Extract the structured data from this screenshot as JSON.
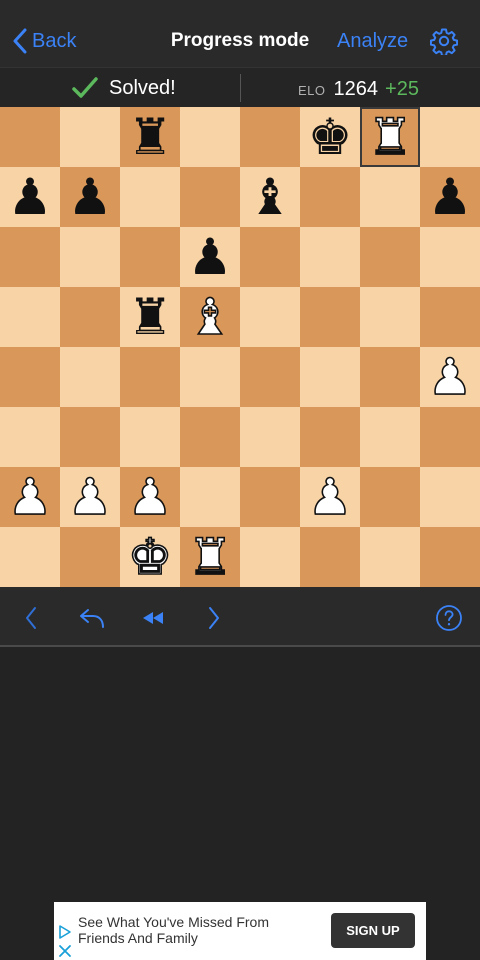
{
  "nav": {
    "back_label": "Back",
    "title": "Progress mode",
    "analyze_label": "Analyze",
    "settings_icon": "gear-icon"
  },
  "status": {
    "solved_label": "Solved!",
    "elo_label": "ELO",
    "elo_value": "1264",
    "elo_change": "+25"
  },
  "colors": {
    "accent": "#3b82f6",
    "success": "#5cb85c",
    "light_square": "#f7d3a6",
    "dark_square": "#d9975a",
    "background": "#232323"
  },
  "board": {
    "orientation": "white-bottom",
    "highlighted_square": "g8",
    "pieces": [
      {
        "square": "c8",
        "type": "rook",
        "color": "black"
      },
      {
        "square": "f8",
        "type": "king",
        "color": "black"
      },
      {
        "square": "g8",
        "type": "rook",
        "color": "white"
      },
      {
        "square": "a7",
        "type": "pawn",
        "color": "black"
      },
      {
        "square": "b7",
        "type": "pawn",
        "color": "black"
      },
      {
        "square": "e7",
        "type": "bishop",
        "color": "black"
      },
      {
        "square": "h7",
        "type": "pawn",
        "color": "black"
      },
      {
        "square": "d6",
        "type": "pawn",
        "color": "black"
      },
      {
        "square": "c5",
        "type": "rook",
        "color": "black"
      },
      {
        "square": "d5",
        "type": "bishop",
        "color": "white"
      },
      {
        "square": "h4",
        "type": "pawn",
        "color": "white"
      },
      {
        "square": "a2",
        "type": "pawn",
        "color": "white"
      },
      {
        "square": "b2",
        "type": "pawn",
        "color": "white"
      },
      {
        "square": "c2",
        "type": "pawn",
        "color": "white"
      },
      {
        "square": "f2",
        "type": "pawn",
        "color": "white"
      },
      {
        "square": "c1",
        "type": "king",
        "color": "white"
      },
      {
        "square": "d1",
        "type": "rook",
        "color": "white"
      }
    ]
  },
  "toolbar": {
    "buttons": [
      "chevron-left-icon",
      "undo-icon",
      "rewind-icon",
      "chevron-right-icon",
      "help-icon"
    ]
  },
  "ad": {
    "text": "See What You've Missed From Friends And Family",
    "cta": "SIGN UP"
  }
}
